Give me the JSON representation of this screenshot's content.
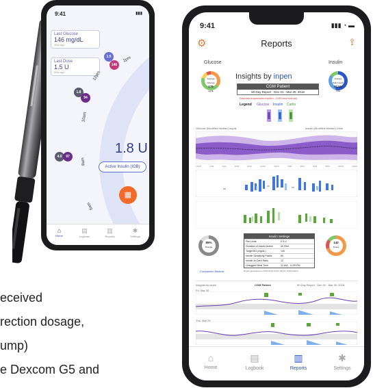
{
  "left_phone": {
    "time": "9:41",
    "last_glucose": {
      "title": "Last Glucose",
      "value": "146 mg/dL",
      "ago": "30m ago"
    },
    "last_dose": {
      "title": "Last Dose",
      "value": "1.5 U",
      "ago": "50m ago"
    },
    "time_labels": [
      "2pm",
      "12pm",
      "10am",
      "8am",
      "6am"
    ],
    "markers": [
      {
        "dose": "1.5",
        "glucose": "146"
      },
      {
        "dose": "1.8",
        "glucose": "94"
      },
      {
        "dose": "4.0",
        "glucose": "97"
      }
    ],
    "active_units": "1.8 U",
    "active_label": "Active Insulin (IOB)",
    "tabs": [
      "Home",
      "Logbook",
      "Reports",
      "Settings"
    ]
  },
  "left_text": {
    "line1": "eceived",
    "line2": "rection dosage,",
    "line3": "ump)",
    "line4": "e Dexcom G5 and"
  },
  "right_phone": {
    "time": "9:41",
    "title": "Reports",
    "glucose_label": "Glucose",
    "insulin_label": "Insulin",
    "brand_prefix": "Insights by ",
    "brand_name": "inpen",
    "patient": "CGM Patient",
    "report_range": "90 Day Report · Dec 01 - Mar 30, 2018",
    "warning": "Data inferred/predicted marked - CGM wear time adj",
    "legend_title": "Legend",
    "legend_items": [
      "Glucose",
      "Insulin",
      "Carbs"
    ],
    "avg_glucose": {
      "label": "Average Glucose",
      "value": "176",
      "unit": "mg/dL"
    },
    "avg_insulin": {
      "label": "Average Daily Insulin",
      "value": "32.5U",
      "unit": "TDD"
    },
    "section_glucose": "Glucose (Modified Median) mg/dL",
    "section_insulin": "Insulin (Modified Median) Units",
    "hours": [
      "12AM",
      "2AM",
      "4AM",
      "6AM",
      "8AM",
      "10AM",
      "12PM",
      "2PM",
      "4PM",
      "6PM",
      "8PM",
      "10PM",
      "12AM"
    ],
    "settings_title": "Insulin Settings",
    "settings_rows": [
      [
        "Pen Units",
        "0.5 U"
      ],
      [
        "Duration of Insulin Action",
        "4h 00m"
      ],
      [
        "Target BG (mg/dL)",
        "140"
      ],
      [
        "Insulin Sensitivity Factor",
        "60"
      ],
      [
        "Insulin-to-Carb Ratio",
        "12"
      ],
      [
        "Unlogged Meal Time",
        "12 AM - 11:59 PM"
      ]
    ],
    "calculator_use": {
      "value": "85%",
      "label": "Dosage"
    },
    "meals": {
      "value": "142",
      "label": "Doses"
    },
    "footer_brand": "Companion Medical",
    "footer_note": "Report generated on 2018-04-01 09:41 AM for CGM Patient",
    "section2_brand": "Insights by inpen",
    "section2_patient": "CGM Patient",
    "section2_range": "90 Day Report · Dec 01 - Mar 30, 2018",
    "day1": "Fri, Mar 30",
    "day2": "Thu, Mar 29",
    "tabs": [
      "Home",
      "Logbook",
      "Reports",
      "Settings"
    ]
  }
}
